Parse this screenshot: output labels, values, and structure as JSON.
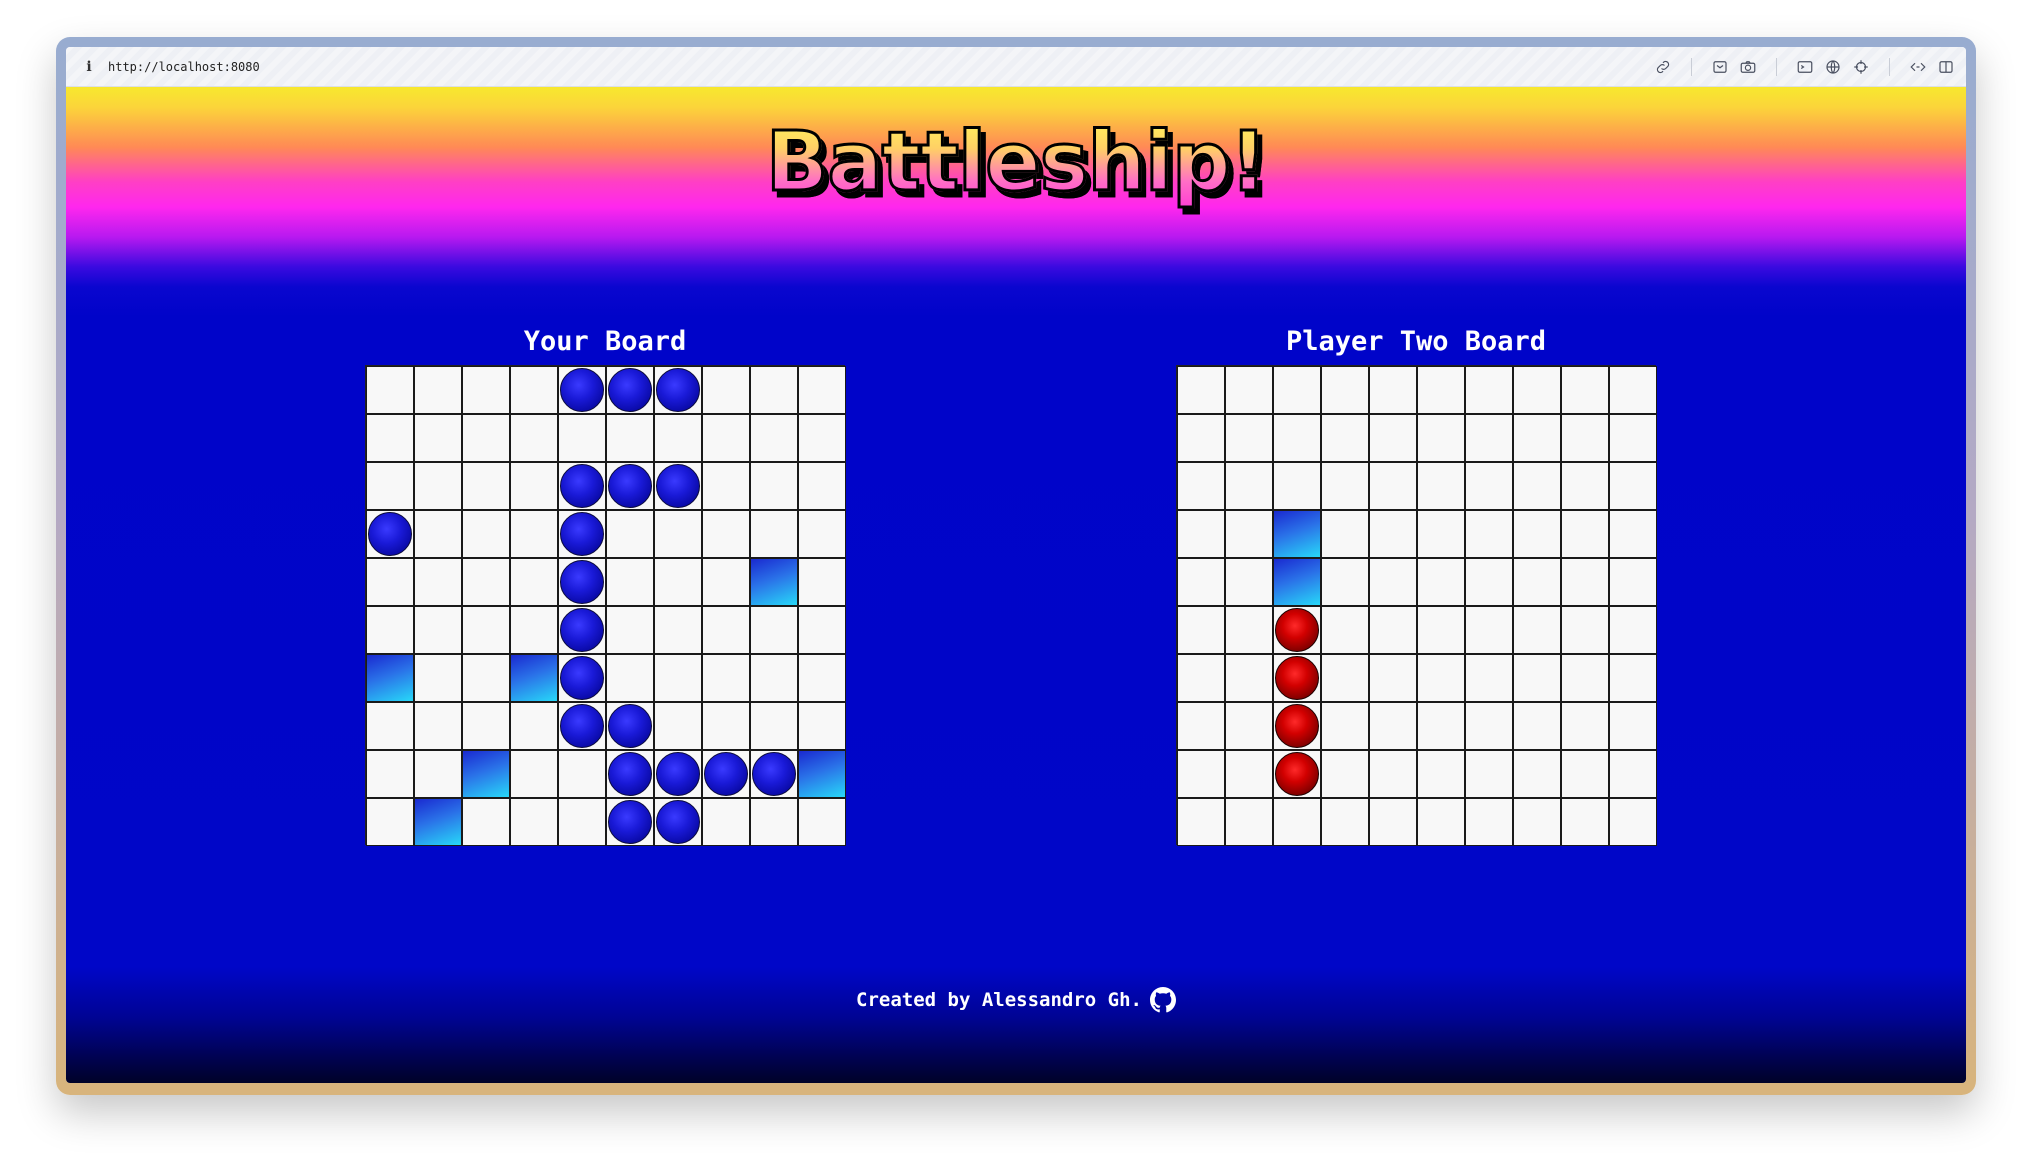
{
  "browser": {
    "url": "http://localhost:8080",
    "info_icon": "info-icon",
    "toolbar_icons": [
      "link-icon",
      "save-icon",
      "camera-icon",
      "terminal-icon",
      "globe-icon",
      "crosshair-icon",
      "code-icon",
      "split-view-icon"
    ]
  },
  "app": {
    "title": "Battleship!",
    "footer_text": "Created by Alessandro Gh.",
    "footer_icon": "github-icon"
  },
  "boards": [
    {
      "title": "Your Board",
      "rows": [
        ". . . . S S S . . .",
        ". . . . . . . . . .",
        ". . . . S S S . . .",
        "S . . . S . . . . .",
        ". . . . S . . . M .",
        ". . . . S . . . . .",
        "M . . M S . . . . .",
        ". . . . S S . . . .",
        ". . M . . S S S S M",
        ". M . . . S S . . ."
      ]
    },
    {
      "title": "Player Two Board",
      "rows": [
        ". . . . . . . . . .",
        ". . . . . . . . . .",
        ". . . . . . . . . .",
        ". . M . . . . . . .",
        ". . M . . . . . . .",
        ". . H . . . . . . .",
        ". . H . . . . . . .",
        ". . H . . . . . . .",
        ". . H . . . . . . .",
        ". . . . . . . . . ."
      ]
    }
  ],
  "legend": {
    "S": "ship",
    "H": "hit",
    "M": "miss",
    ".": "empty"
  },
  "colors": {
    "ship": "#1a1ad8",
    "hit": "#d20000",
    "miss": "#28d8f8",
    "background": "#0004c9"
  }
}
